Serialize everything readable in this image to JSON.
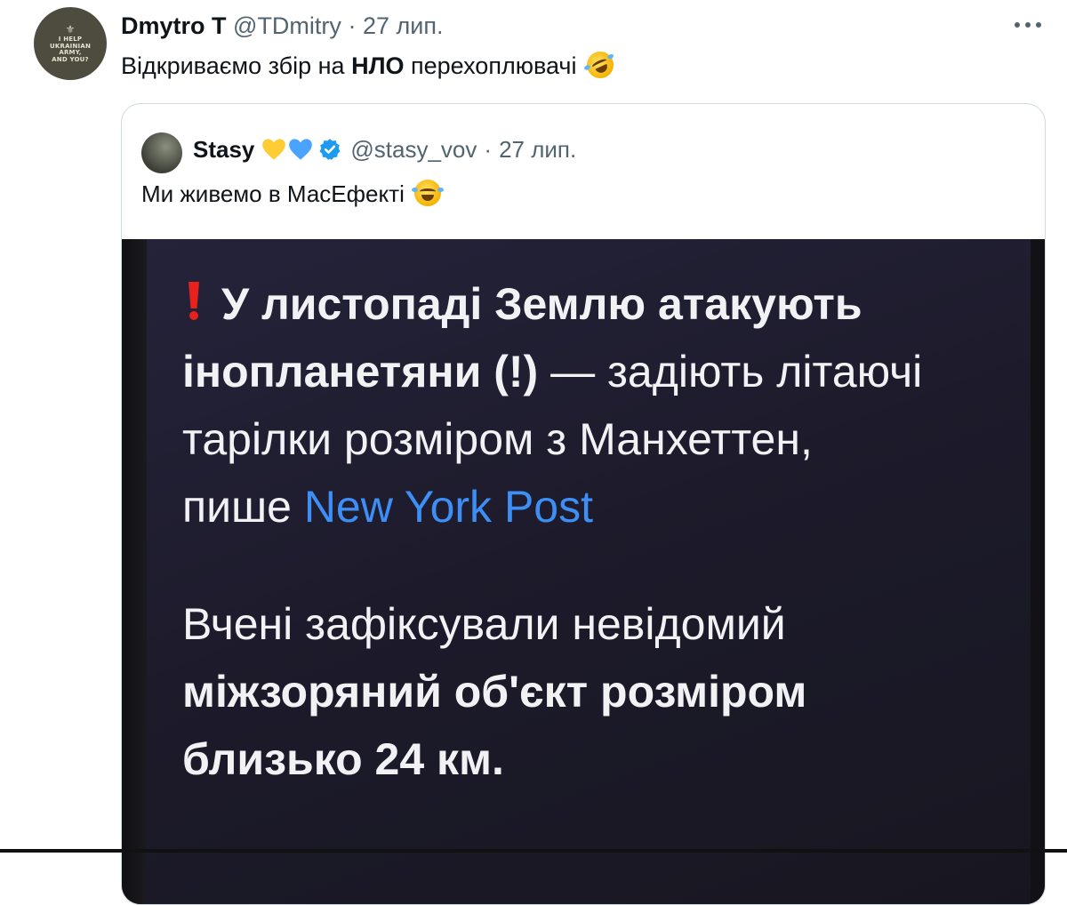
{
  "tweet": {
    "avatar_text": "I HELP\nUKRAINIAN\nARMY,\nAND YOU?",
    "author_name": "Dmytro T",
    "author_handle": "@TDmitry",
    "separator": "·",
    "date": "27 лип.",
    "text_before": "Відкриваємо збір на ",
    "text_bold": "НЛО",
    "text_after": " перехоплювачі",
    "text_emoji": "rolling-on-floor-laughing-emoji",
    "more_icon": "more-horizontal-icon"
  },
  "quote": {
    "author_name": "Stasy",
    "badges": [
      "yellow-heart-icon",
      "blue-heart-icon",
      "verified-badge-icon"
    ],
    "colors": {
      "yellow_heart": "#ffcc33",
      "blue_heart": "#4aa3ff",
      "verified": "#1d9bf0",
      "link": "#3d8ff5"
    },
    "author_handle": "@stasy_vov",
    "separator": "·",
    "date": "27 лип.",
    "text": "Ми живемо в МасЕфекті",
    "text_emoji": "face-with-tears-of-joy-emoji",
    "media": {
      "line1": "У листопаді Землю атакують",
      "line2_bold": "інопланетяни (!)",
      "line2_rest": " — задіють літаючі",
      "line3": "тарілки розміром з Манхеттен,",
      "line4_text": "пише ",
      "line4_link": "New York Post",
      "line5": "Вчені зафіксували невідомий",
      "line6": "міжзоряний об'єкт розміром",
      "line7": "близько 24 км."
    }
  }
}
